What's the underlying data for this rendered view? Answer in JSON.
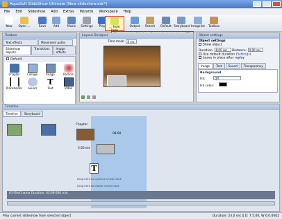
{
  "window": {
    "title": "AquaSoft SlideShow Ultimate [New slideshow.adr*]"
  },
  "menu": [
    "File",
    "Edit",
    "Slideshow",
    "Add",
    "Extras",
    "Wizards",
    "Workspace",
    "Help"
  ],
  "toolbar": [
    {
      "label": "New",
      "icon": "new-doc-icon",
      "color": "#ffffff"
    },
    {
      "label": "Open ...",
      "icon": "folder-icon",
      "color": "#e8c050"
    },
    {
      "label": "Save",
      "icon": "floppy-icon",
      "color": "#4d78c8"
    },
    {
      "label": "Add",
      "icon": "add-image-icon",
      "color": "#7aa8d8"
    },
    {
      "label": "Music",
      "icon": "music-icon",
      "color": "#5a88c8"
    },
    {
      "label": "Settings",
      "icon": "settings-icon",
      "color": "#9aa0b0"
    },
    {
      "label": "Play",
      "icon": "play-icon",
      "color": "#3a6fc8"
    },
    {
      "label": "... from here",
      "icon": "play-from-here-icon",
      "color": "#d8e060"
    },
    {
      "label": "Output",
      "icon": "output-icon",
      "color": "#6a9ad8"
    },
    {
      "label": "Search",
      "icon": "search-icon",
      "color": "#c0a060"
    },
    {
      "label": "Default",
      "icon": "default-layout-icon",
      "color": "#6a88b8"
    },
    {
      "label": "Storyboard",
      "icon": "storyboard-icon",
      "color": "#7a98c8"
    },
    {
      "label": "Imagelist",
      "icon": "imagelist-icon",
      "color": "#8ab0d8"
    },
    {
      "label": "Toolbox",
      "icon": "toolbox-icon",
      "color": "#c89050"
    }
  ],
  "tooltip": "Play current slideshow from selected object (F6)",
  "toolbox": {
    "title": "Toolbox",
    "tabs_top": [
      "Text effects",
      "Movement paths"
    ],
    "tabs_bottom": [
      "Slideshow objects",
      "Transitions",
      "Image effects"
    ],
    "group": "Default",
    "items": [
      "Chapter",
      "Collage",
      "Image",
      "Particle",
      "Placeholder",
      "Sound",
      "Text",
      "Video"
    ]
  },
  "designer": {
    "title": "Layout Designer",
    "time_label": "Time mark:",
    "time_value": "8 sec"
  },
  "settings": {
    "title": "Object settings",
    "section": "Object settings",
    "show_object": "Show object",
    "duration_label": "Duration:",
    "duration_value": "8:00 sec",
    "distance_label": "Distance:",
    "distance_value": "0:00 sec",
    "use_default": "Use default duration (",
    "use_default_link": "Settings",
    "use_default_end": ")",
    "leave_in_place": "Leave in place after replay",
    "tabs": [
      "Image",
      "Text",
      "Sound",
      "Transparency"
    ],
    "background": "Background",
    "fill_label": "Fill:",
    "fill_value": "Off",
    "fill_color_label": "Fill color:"
  },
  "timeline": {
    "title": "Timeline",
    "tabs": [
      "Timeline",
      "Storyboard"
    ],
    "chapter": "Chapter",
    "clip_time": "08:00",
    "dur1": "3.60 sec",
    "drag_text": "Drag here to connect a new track",
    "drag_text2": "Drag here to create a new track",
    "audio": "01-Titel1.wma  Duration: 03:09:000 min"
  },
  "status": {
    "left": "Play current slideshow from selected object",
    "right": "Duration: 23.0 sec    ‖  D: 7.5.00, W 6.0.0002"
  }
}
